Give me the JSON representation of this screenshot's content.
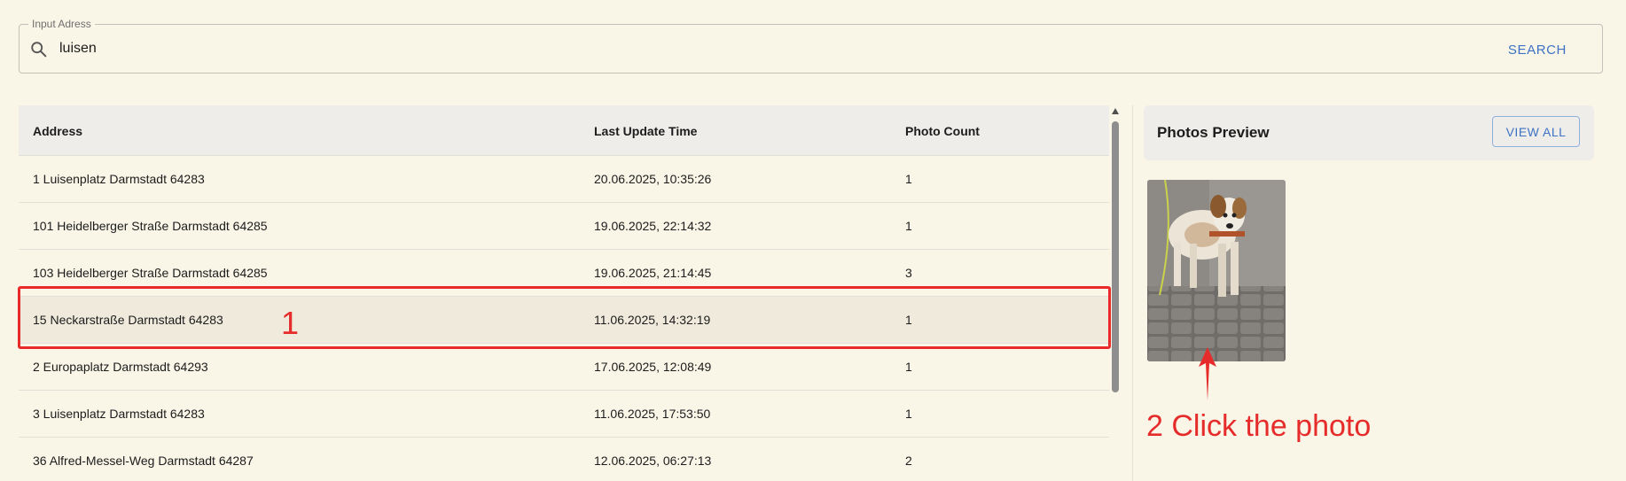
{
  "search": {
    "legend": "Input Adress",
    "value": "luisen",
    "button_label": "SEARCH"
  },
  "table": {
    "headers": {
      "address": "Address",
      "time": "Last Update Time",
      "count": "Photo Count"
    },
    "rows": [
      {
        "address": "1 Luisenplatz Darmstadt 64283",
        "time": "20.06.2025, 10:35:26",
        "count": "1"
      },
      {
        "address": "101 Heidelberger Straße Darmstadt 64285",
        "time": "19.06.2025, 22:14:32",
        "count": "1"
      },
      {
        "address": "103 Heidelberger Straße Darmstadt 64285",
        "time": "19.06.2025, 21:14:45",
        "count": "3"
      },
      {
        "address": "15 Neckarstraße Darmstadt 64283",
        "time": "11.06.2025, 14:32:19",
        "count": "1"
      },
      {
        "address": "2 Europaplatz Darmstadt 64293",
        "time": "17.06.2025, 12:08:49",
        "count": "1"
      },
      {
        "address": "3 Luisenplatz Darmstadt 64283",
        "time": "11.06.2025, 17:53:50",
        "count": "1"
      },
      {
        "address": "36 Alfred-Messel-Weg Darmstadt 64287",
        "time": "12.06.2025, 06:27:13",
        "count": "2"
      }
    ],
    "selected_row": 3
  },
  "preview": {
    "title": "Photos Preview",
    "view_all_label": "VIEW ALL"
  },
  "annotations": {
    "step1": "1",
    "step2": "2 Click the photo"
  },
  "colors": {
    "background": "#f9f5e7",
    "accent": "#3d72c4",
    "annotation": "#e62b2b",
    "header_bg": "#efedea"
  },
  "icons": {
    "search": "search-icon",
    "photo": "dog-photo-thumbnail",
    "arrow": "arrow-up-icon"
  }
}
